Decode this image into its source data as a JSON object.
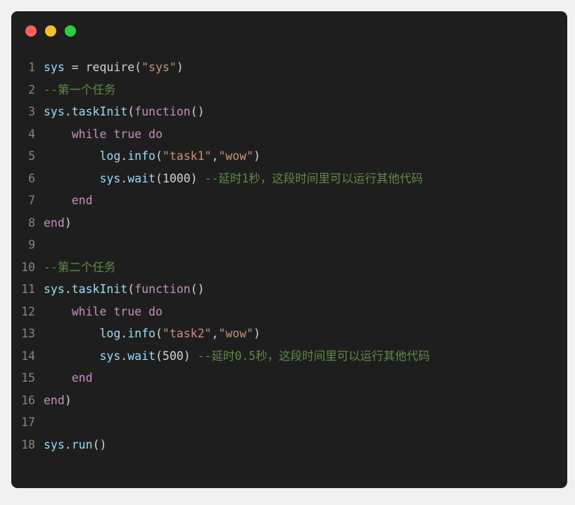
{
  "window": {
    "traffic_lights": [
      {
        "name": "close",
        "color": "#f6615c"
      },
      {
        "name": "minimize",
        "color": "#f8bd2e"
      },
      {
        "name": "maximize",
        "color": "#2ecc40"
      }
    ],
    "background": "#1e1e1e",
    "page_background": "#f1f1f1"
  },
  "editor": {
    "language": "lua",
    "gutter_color": "#868686",
    "palette": {
      "plain": "#d4d4d4",
      "variable": "#9cdcfe",
      "function": "#9cdcfe",
      "string": "#ce9178",
      "comment": "#5f8c48",
      "keyword": "#c98fc6"
    },
    "lines": [
      {
        "number": "1",
        "text": "sys = require(\"sys\")",
        "tokens": [
          {
            "t": "sys",
            "c": "t-var"
          },
          {
            "t": " = ",
            "c": "t-punct"
          },
          {
            "t": "require",
            "c": "t-plain"
          },
          {
            "t": "(",
            "c": "t-punct"
          },
          {
            "t": "\"sys\"",
            "c": "t-string"
          },
          {
            "t": ")",
            "c": "t-punct"
          }
        ]
      },
      {
        "number": "2",
        "text": "--第一个任务",
        "tokens": [
          {
            "t": "--第一个任务",
            "c": "t-comment"
          }
        ]
      },
      {
        "number": "3",
        "text": "sys.taskInit(function()",
        "tokens": [
          {
            "t": "sys",
            "c": "t-var"
          },
          {
            "t": ".",
            "c": "t-punct"
          },
          {
            "t": "taskInit",
            "c": "t-func"
          },
          {
            "t": "(",
            "c": "t-punct"
          },
          {
            "t": "function",
            "c": "t-keyword"
          },
          {
            "t": "()",
            "c": "t-punct"
          }
        ]
      },
      {
        "number": "4",
        "text": "    while true do",
        "tokens": [
          {
            "t": "    ",
            "c": "t-plain"
          },
          {
            "t": "while true do",
            "c": "t-keyword"
          }
        ]
      },
      {
        "number": "5",
        "text": "        log.info(\"task1\",\"wow\")",
        "tokens": [
          {
            "t": "        ",
            "c": "t-plain"
          },
          {
            "t": "log",
            "c": "t-var"
          },
          {
            "t": ".",
            "c": "t-punct"
          },
          {
            "t": "info",
            "c": "t-func"
          },
          {
            "t": "(",
            "c": "t-punct"
          },
          {
            "t": "\"task1\"",
            "c": "t-string"
          },
          {
            "t": ",",
            "c": "t-punct"
          },
          {
            "t": "\"wow\"",
            "c": "t-string"
          },
          {
            "t": ")",
            "c": "t-punct"
          }
        ]
      },
      {
        "number": "6",
        "text": "        sys.wait(1000) --延时1秒，这段时间里可以运行其他代码",
        "tokens": [
          {
            "t": "        ",
            "c": "t-plain"
          },
          {
            "t": "sys",
            "c": "t-var"
          },
          {
            "t": ".",
            "c": "t-punct"
          },
          {
            "t": "wait",
            "c": "t-func"
          },
          {
            "t": "(",
            "c": "t-punct"
          },
          {
            "t": "1000",
            "c": "t-number"
          },
          {
            "t": ") ",
            "c": "t-punct"
          },
          {
            "t": "--延时1秒，这段时间里可以运行其他代码",
            "c": "t-comment"
          }
        ]
      },
      {
        "number": "7",
        "text": "    end",
        "tokens": [
          {
            "t": "    ",
            "c": "t-plain"
          },
          {
            "t": "end",
            "c": "t-keyword"
          }
        ]
      },
      {
        "number": "8",
        "text": "end)",
        "tokens": [
          {
            "t": "end",
            "c": "t-keyword"
          },
          {
            "t": ")",
            "c": "t-punct"
          }
        ]
      },
      {
        "number": "9",
        "text": "",
        "tokens": []
      },
      {
        "number": "10",
        "text": "--第二个任务",
        "tokens": [
          {
            "t": "--第二个任务",
            "c": "t-comment"
          }
        ]
      },
      {
        "number": "11",
        "text": "sys.taskInit(function()",
        "tokens": [
          {
            "t": "sys",
            "c": "t-var"
          },
          {
            "t": ".",
            "c": "t-punct"
          },
          {
            "t": "taskInit",
            "c": "t-func"
          },
          {
            "t": "(",
            "c": "t-punct"
          },
          {
            "t": "function",
            "c": "t-keyword"
          },
          {
            "t": "()",
            "c": "t-punct"
          }
        ]
      },
      {
        "number": "12",
        "text": "    while true do",
        "tokens": [
          {
            "t": "    ",
            "c": "t-plain"
          },
          {
            "t": "while true do",
            "c": "t-keyword"
          }
        ]
      },
      {
        "number": "13",
        "text": "        log.info(\"task2\",\"wow\")",
        "tokens": [
          {
            "t": "        ",
            "c": "t-plain"
          },
          {
            "t": "log",
            "c": "t-var"
          },
          {
            "t": ".",
            "c": "t-punct"
          },
          {
            "t": "info",
            "c": "t-func"
          },
          {
            "t": "(",
            "c": "t-punct"
          },
          {
            "t": "\"task2\"",
            "c": "t-string"
          },
          {
            "t": ",",
            "c": "t-punct"
          },
          {
            "t": "\"wow\"",
            "c": "t-string"
          },
          {
            "t": ")",
            "c": "t-punct"
          }
        ]
      },
      {
        "number": "14",
        "text": "        sys.wait(500) --延时0.5秒，这段时间里可以运行其他代码",
        "tokens": [
          {
            "t": "        ",
            "c": "t-plain"
          },
          {
            "t": "sys",
            "c": "t-var"
          },
          {
            "t": ".",
            "c": "t-punct"
          },
          {
            "t": "wait",
            "c": "t-func"
          },
          {
            "t": "(",
            "c": "t-punct"
          },
          {
            "t": "500",
            "c": "t-number"
          },
          {
            "t": ") ",
            "c": "t-punct"
          },
          {
            "t": "--延时0.5秒，这段时间里可以运行其他代码",
            "c": "t-comment"
          }
        ]
      },
      {
        "number": "15",
        "text": "    end",
        "tokens": [
          {
            "t": "    ",
            "c": "t-plain"
          },
          {
            "t": "end",
            "c": "t-keyword"
          }
        ]
      },
      {
        "number": "16",
        "text": "end)",
        "tokens": [
          {
            "t": "end",
            "c": "t-keyword"
          },
          {
            "t": ")",
            "c": "t-punct"
          }
        ]
      },
      {
        "number": "17",
        "text": "",
        "tokens": []
      },
      {
        "number": "18",
        "text": "sys.run()",
        "tokens": [
          {
            "t": "sys",
            "c": "t-var"
          },
          {
            "t": ".",
            "c": "t-punct"
          },
          {
            "t": "run",
            "c": "t-func"
          },
          {
            "t": "()",
            "c": "t-punct"
          }
        ]
      }
    ]
  }
}
